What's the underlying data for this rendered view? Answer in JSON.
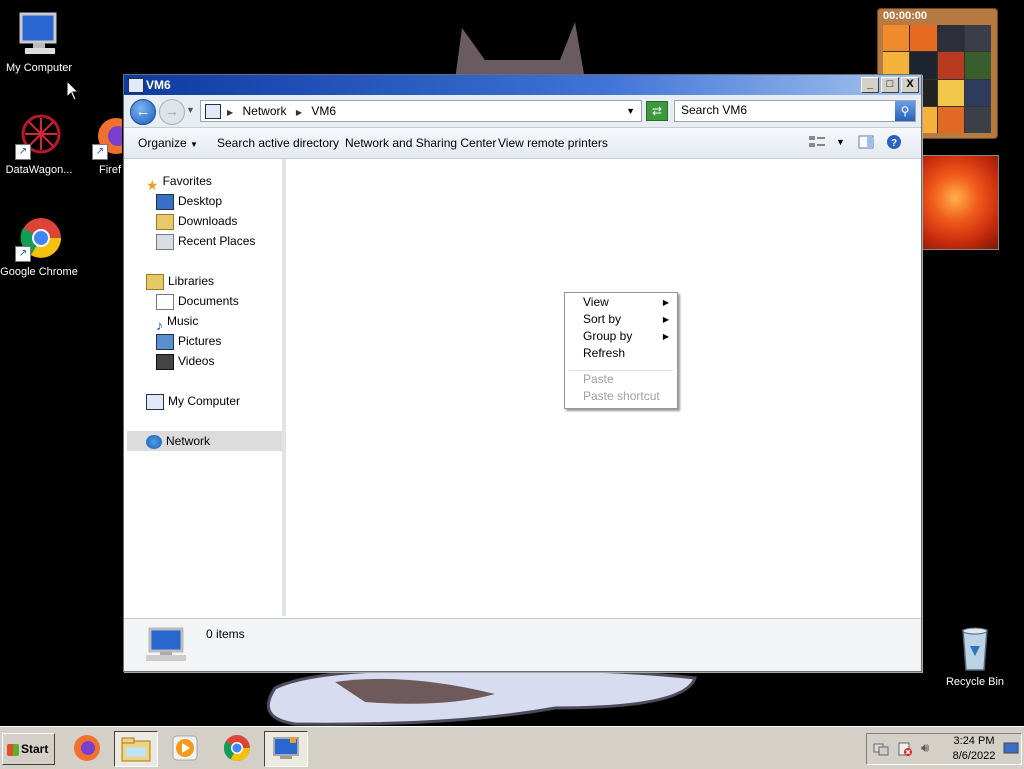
{
  "desktop": {
    "icons": [
      {
        "label": "My Computer"
      },
      {
        "label": "DataWagon..."
      },
      {
        "label": "Firef"
      },
      {
        "label": "Google Chrome"
      },
      {
        "label": "Recycle Bin"
      }
    ],
    "puzzle_gadget": {
      "timer": "00:00:00"
    }
  },
  "window": {
    "title": "VM6",
    "controls": {
      "minimize": "_",
      "maximize": "□",
      "close": "X"
    },
    "address": {
      "crumbs": [
        "Network",
        "VM6"
      ]
    },
    "search": {
      "value": "Search VM6"
    },
    "toolbar": {
      "organize": "Organize",
      "search_ad": "Search active directory",
      "network_sharing": "Network and Sharing Center",
      "view_printers": "View remote printers"
    },
    "navpane": {
      "favorites": "Favorites",
      "desktop": "Desktop",
      "downloads": "Downloads",
      "recent": "Recent Places",
      "libraries": "Libraries",
      "documents": "Documents",
      "music": "Music",
      "pictures": "Pictures",
      "videos": "Videos",
      "my_computer": "My Computer",
      "network": "Network"
    },
    "status": {
      "items": "0 items"
    }
  },
  "context_menu": {
    "view": "View",
    "sort_by": "Sort by",
    "group_by": "Group by",
    "refresh": "Refresh",
    "paste": "Paste",
    "paste_shortcut": "Paste shortcut"
  },
  "taskbar": {
    "start": "Start",
    "time": "3:24 PM",
    "date": "8/6/2022"
  }
}
